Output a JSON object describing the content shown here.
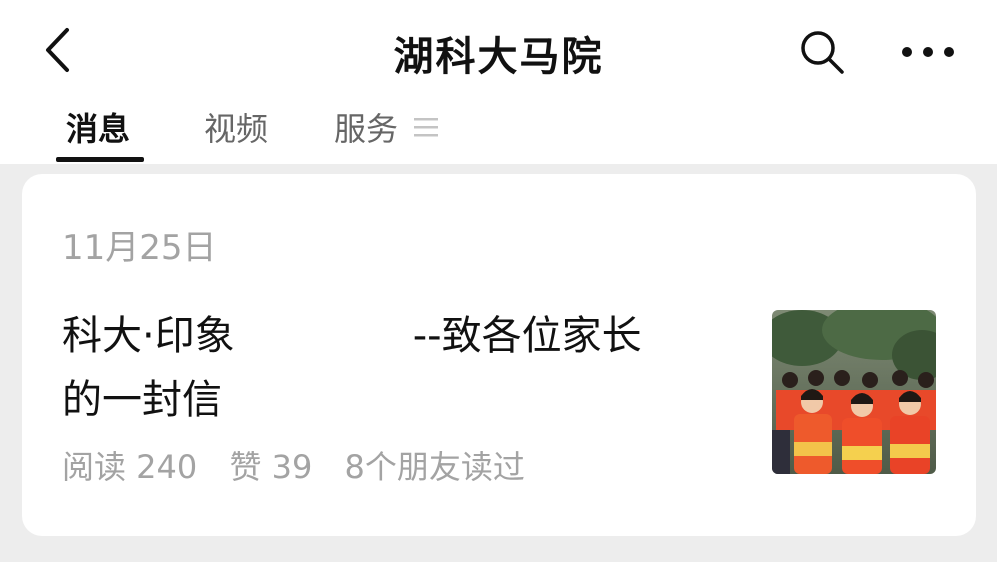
{
  "header": {
    "title": "湖科大马院",
    "back_icon": "chevron-left-icon",
    "search_icon": "search-icon",
    "more_icon": "more-dots-icon"
  },
  "tabs": [
    {
      "label": "消息",
      "active": true
    },
    {
      "label": "视频",
      "active": false
    },
    {
      "label": "服务",
      "active": false
    }
  ],
  "article": {
    "date": "11月25日",
    "title": "科大·印象              --致各位家长\n的一封信",
    "reads": "阅读 240",
    "likes": "赞 39",
    "friends": "8个朋友读过",
    "thumbnail": "photo-students-in-orange-jackets"
  },
  "colors": {
    "background": "#ededed",
    "card": "#ffffff",
    "muted_text": "#a3a3a3",
    "primary_text": "#111111"
  }
}
